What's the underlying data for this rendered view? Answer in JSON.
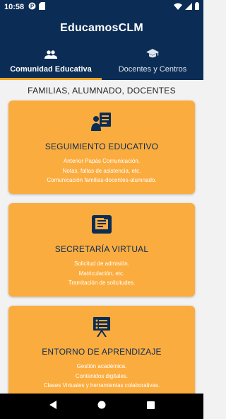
{
  "status": {
    "time": "10:58"
  },
  "app": {
    "title": "EducamosCLM"
  },
  "tabs": [
    {
      "label": "Comunidad Educativa",
      "icon": "people-icon",
      "active": true
    },
    {
      "label": "Docentes y Centros",
      "icon": "graduation-cap-icon",
      "active": false
    }
  ],
  "subtitle": "FAMILIAS, ALUMNADO, DOCENTES",
  "cards": [
    {
      "icon": "person-document-icon",
      "title": "SEGUIMIENTO EDUCATIVO",
      "lines": [
        "Anterior Papás Comunicación.",
        "Notas, faltas de asistencia, etc.",
        "Comunicación familias-docentes-alumnado."
      ]
    },
    {
      "icon": "folder-document-icon",
      "title": "SECRETARÍA VIRTUAL",
      "lines": [
        "Solicitud de admisión.",
        "Matriculación, etc.",
        "Tramitación de solicitudes."
      ]
    },
    {
      "icon": "presentation-board-icon",
      "title": "ENTORNO DE APRENDIZAJE",
      "lines": [
        "Gestión académica.",
        "Contenidos digitales.",
        "Clases Virtuales y herramientas colaborativas."
      ]
    }
  ],
  "colors": {
    "primary": "#0b2c55",
    "accent": "#f5a623",
    "card": "#fbac3f"
  }
}
